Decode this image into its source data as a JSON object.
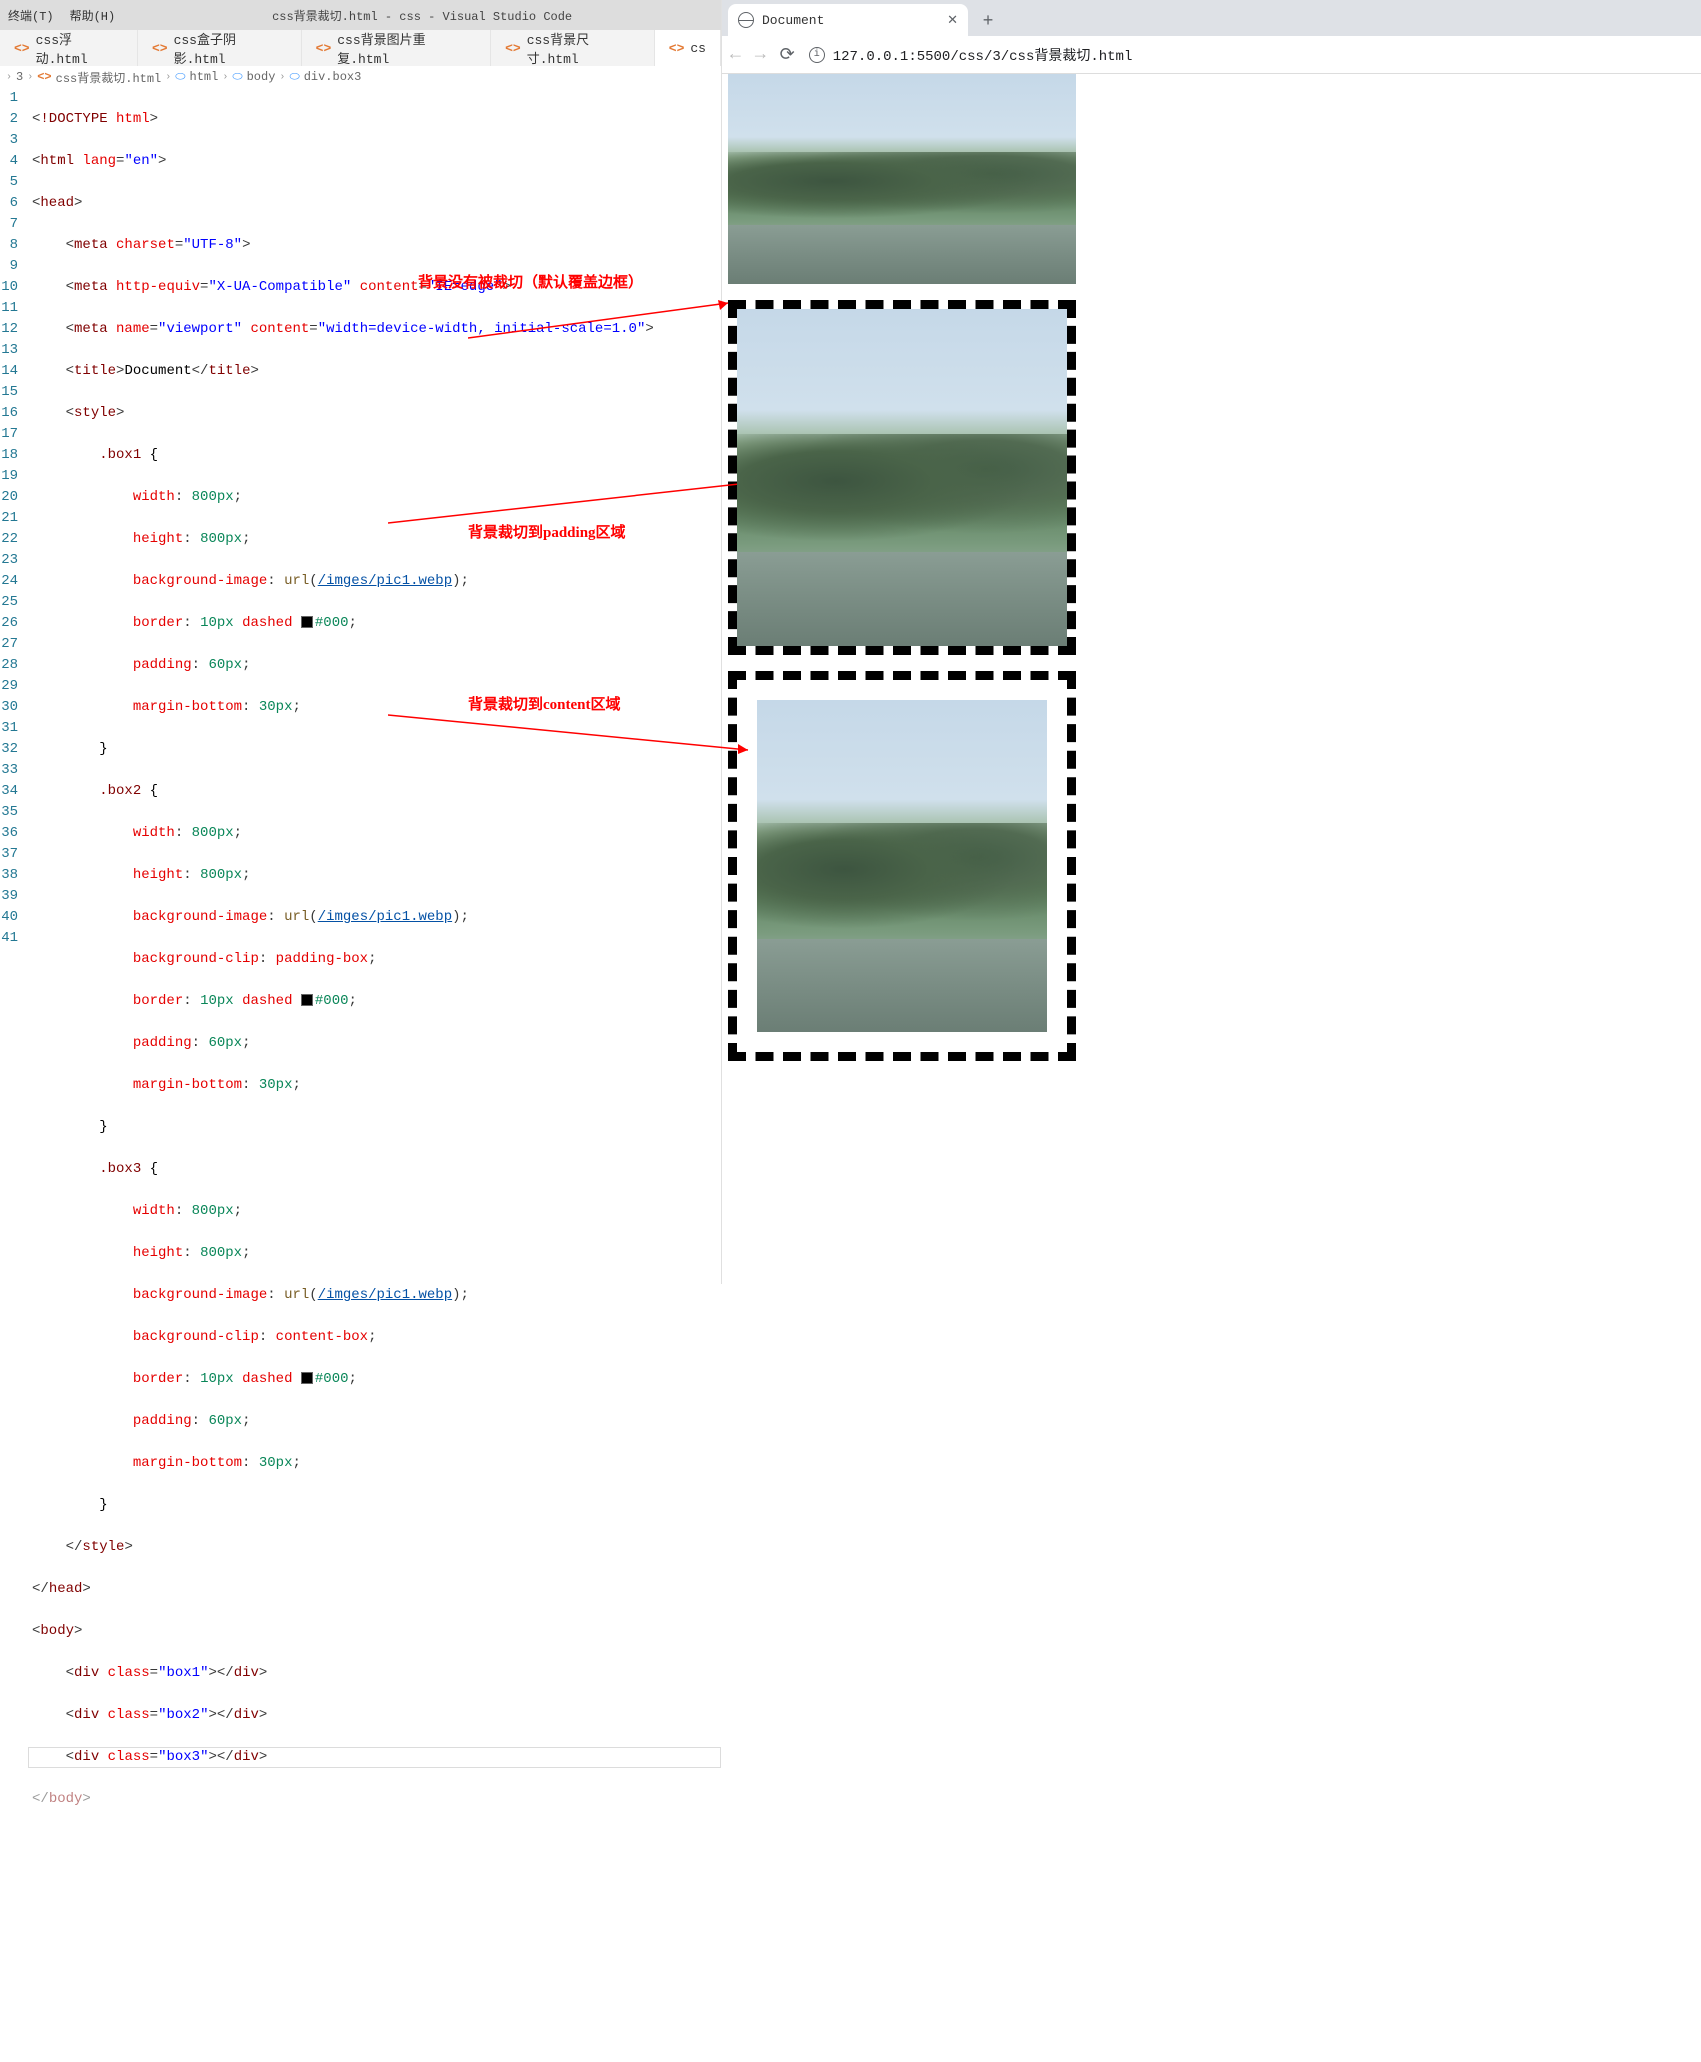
{
  "vscode": {
    "menu": {
      "terminal": "终端(T)",
      "help": "帮助(H)"
    },
    "title": "css背景裁切.html - css - Visual Studio Code",
    "tabs": [
      {
        "label": "css浮动.html"
      },
      {
        "label": "css盒子阴影.html"
      },
      {
        "label": "css背景图片重复.html"
      },
      {
        "label": "css背景尺寸.html"
      },
      {
        "label": "cs"
      }
    ],
    "breadcrumb": {
      "p1": "3",
      "p2": "css背景裁切.html",
      "p3": "html",
      "p4": "body",
      "p5": "div.box3"
    },
    "annotations": {
      "a1": "背景没有被裁切（默认覆盖边框）",
      "a2": "背景裁切到padding区域",
      "a3": "背景裁切到content区域"
    },
    "code": {
      "doctype_kw": "!DOCTYPE",
      "doctype_val": "html",
      "lang_attr": "lang",
      "lang_val": "\"en\"",
      "charset_attr": "charset",
      "charset_val": "\"UTF-8\"",
      "httpequiv_attr": "http-equiv",
      "httpequiv_val": "\"X-UA-Compatible\"",
      "content_attr": "content",
      "ie_val": "\"IE=edge\"",
      "name_attr": "name",
      "viewport_val": "\"viewport\"",
      "viewport_content": "\"width=device-width, initial-scale=1.0\"",
      "title_text": "Document",
      "sel_box1": ".box1",
      "sel_box2": ".box2",
      "sel_box3": ".box3",
      "prop_width": "width",
      "val_800": "800px",
      "prop_height": "height",
      "prop_bgimg": "background-image",
      "func_url": "url",
      "url_path": "/imges/pic1.webp",
      "prop_border": "border",
      "val_10px": "10px",
      "val_dashed": "dashed",
      "val_000": "#000",
      "prop_padding": "padding",
      "val_60": "60px",
      "prop_mb": "margin-bottom",
      "val_30": "30px",
      "prop_bgclip": "background-clip",
      "val_padbox": "padding-box",
      "val_contbox": "content-box",
      "attr_class": "class",
      "cls_box1": "\"box1\"",
      "cls_box2": "\"box2\"",
      "cls_box3": "\"box3\""
    }
  },
  "browser": {
    "tab_title": "Document",
    "url": "127.0.0.1:5500/css/3/css背景裁切.html"
  }
}
